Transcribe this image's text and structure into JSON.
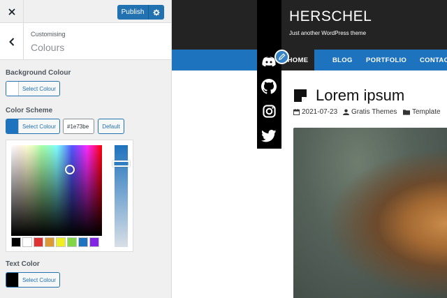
{
  "app": {
    "close_icon": "close-icon",
    "publish_label": "Publish"
  },
  "section": {
    "breadcrumb": "Customising",
    "title": "Colours"
  },
  "controls": {
    "background": {
      "label": "Background Colour",
      "button": "Select Colour",
      "color": "#ffffff"
    },
    "scheme": {
      "label": "Color Scheme",
      "button": "Select Colour",
      "hex": "#1e73be",
      "default_label": "Default",
      "color": "#1e73be"
    },
    "text": {
      "label": "Text Color",
      "button": "Select Colour",
      "color": "#000000"
    }
  },
  "picker": {
    "palette": [
      "#000000",
      "#ffffff",
      "#dd3333",
      "#dd9933",
      "#eeee22",
      "#81d742",
      "#1e73be",
      "#8224e3"
    ]
  },
  "site": {
    "title": "HERSCHEL",
    "tagline": "Just another WordPress theme",
    "social_icons": [
      "discord-icon",
      "github-icon",
      "instagram-icon",
      "twitter-icon"
    ],
    "nav": [
      "HOME",
      "BLOG",
      "PORTFOLIO",
      "CONTAC"
    ],
    "post": {
      "title": "Lorem ipsum",
      "date": "2021-07-23",
      "author": "Gratis Themes",
      "category": "Template"
    }
  }
}
